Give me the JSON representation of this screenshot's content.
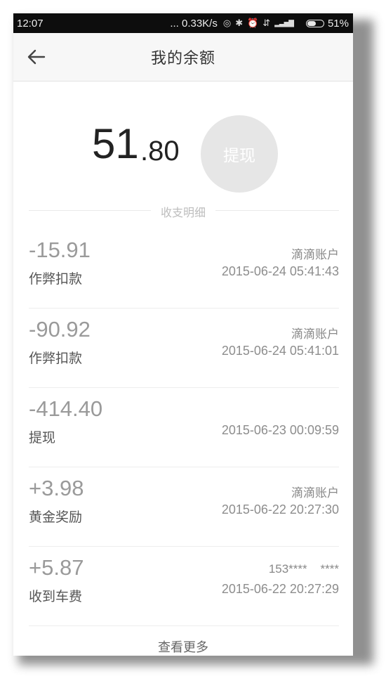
{
  "status_bar": {
    "time": "12:07",
    "speed": "... 0.33K/s",
    "battery": "51%",
    "battery_level": 0.51,
    "icons": [
      "data-saver-icon",
      "bluetooth-icon",
      "alarm-icon",
      "vibrate-icon",
      "signal-icon"
    ]
  },
  "header": {
    "title": "我的余额",
    "back_icon": "arrow-left-icon"
  },
  "balance": {
    "integer": "51",
    "decimal": ".80",
    "withdraw_label": "提现"
  },
  "section": {
    "label": "收支明细"
  },
  "transactions": [
    {
      "amount": "-15.91",
      "desc": "作弊扣款",
      "source": "滴滴账户",
      "time": "2015-06-24 05:41:43"
    },
    {
      "amount": "-90.92",
      "desc": "作弊扣款",
      "source": "滴滴账户",
      "time": "2015-06-24 05:41:01"
    },
    {
      "amount": "-414.40",
      "desc": "提现",
      "source": "",
      "time": "2015-06-23 00:09:59"
    },
    {
      "amount": "+3.98",
      "desc": "黄金奖励",
      "source": "滴滴账户",
      "time": "2015-06-22 20:27:30"
    },
    {
      "amount": "+5.87",
      "desc": "收到车费",
      "source": "153****    ****",
      "time": "2015-06-22 20:27:29"
    }
  ],
  "footer": {
    "more_label": "查看更多"
  }
}
